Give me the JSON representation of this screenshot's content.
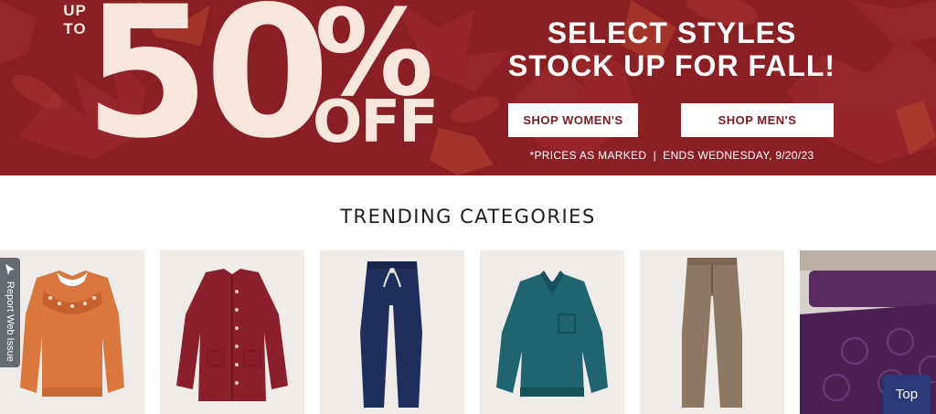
{
  "banner": {
    "up_to": "UP TO",
    "percent_number": "50",
    "percent_sign": "%",
    "off_text": "OFF",
    "asterisk": "*",
    "headline_line1": "SELECT STYLES",
    "headline_line2": "STOCK UP FOR FALL!",
    "shop_women_label": "SHOP WOMEN'S",
    "shop_men_label": "SHOP MEN'S",
    "fineprint": "*PRICES AS MARKED  |  ENDS WEDNESDAY, 9/20/23",
    "colors": {
      "background": "#8a1f24",
      "text_cream": "#f6e6dc",
      "button_text": "#7a1c20"
    }
  },
  "trending": {
    "title": "TRENDING CATEGORIES",
    "tiles": [
      {
        "icon": "orange-fairisle-sweater"
      },
      {
        "icon": "burgundy-button-cardigan"
      },
      {
        "icon": "navy-drawstring-pants"
      },
      {
        "icon": "teal-banded-pullover"
      },
      {
        "icon": "taupe-dress-pants"
      },
      {
        "icon": "purple-chenille-bedspread"
      }
    ]
  },
  "widgets": {
    "report_label": "Report Web Issue",
    "top_label": "Top"
  }
}
